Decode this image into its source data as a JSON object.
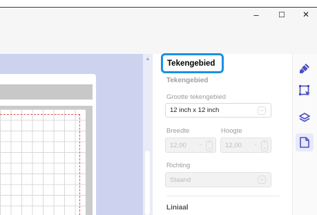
{
  "window": {
    "minimize_glyph": "–",
    "maximize_glyph": "☐",
    "close_glyph": "✕"
  },
  "panel": {
    "header_title": "Tekengebied",
    "section_title": "Tekengebied",
    "size_label": "Grootte tekengebied",
    "size_value": "12 inch x 12 inch",
    "width_label": "Breedte",
    "width_value": "12,00",
    "height_label": "Hoogte",
    "height_value": "12,00",
    "orientation_label": "Richting",
    "orientation_value": "Staand",
    "ruler_label": "Liniaal"
  },
  "rail": {
    "icons": [
      "brush-icon",
      "select-area-icon",
      "layers-icon",
      "page-icon"
    ],
    "active": "page-icon"
  },
  "colors": {
    "highlight": "#1a8fe3",
    "rail_icon": "#4b4fc4",
    "canvas_bg": "#cdd3ee",
    "cut_line": "#e05555"
  }
}
